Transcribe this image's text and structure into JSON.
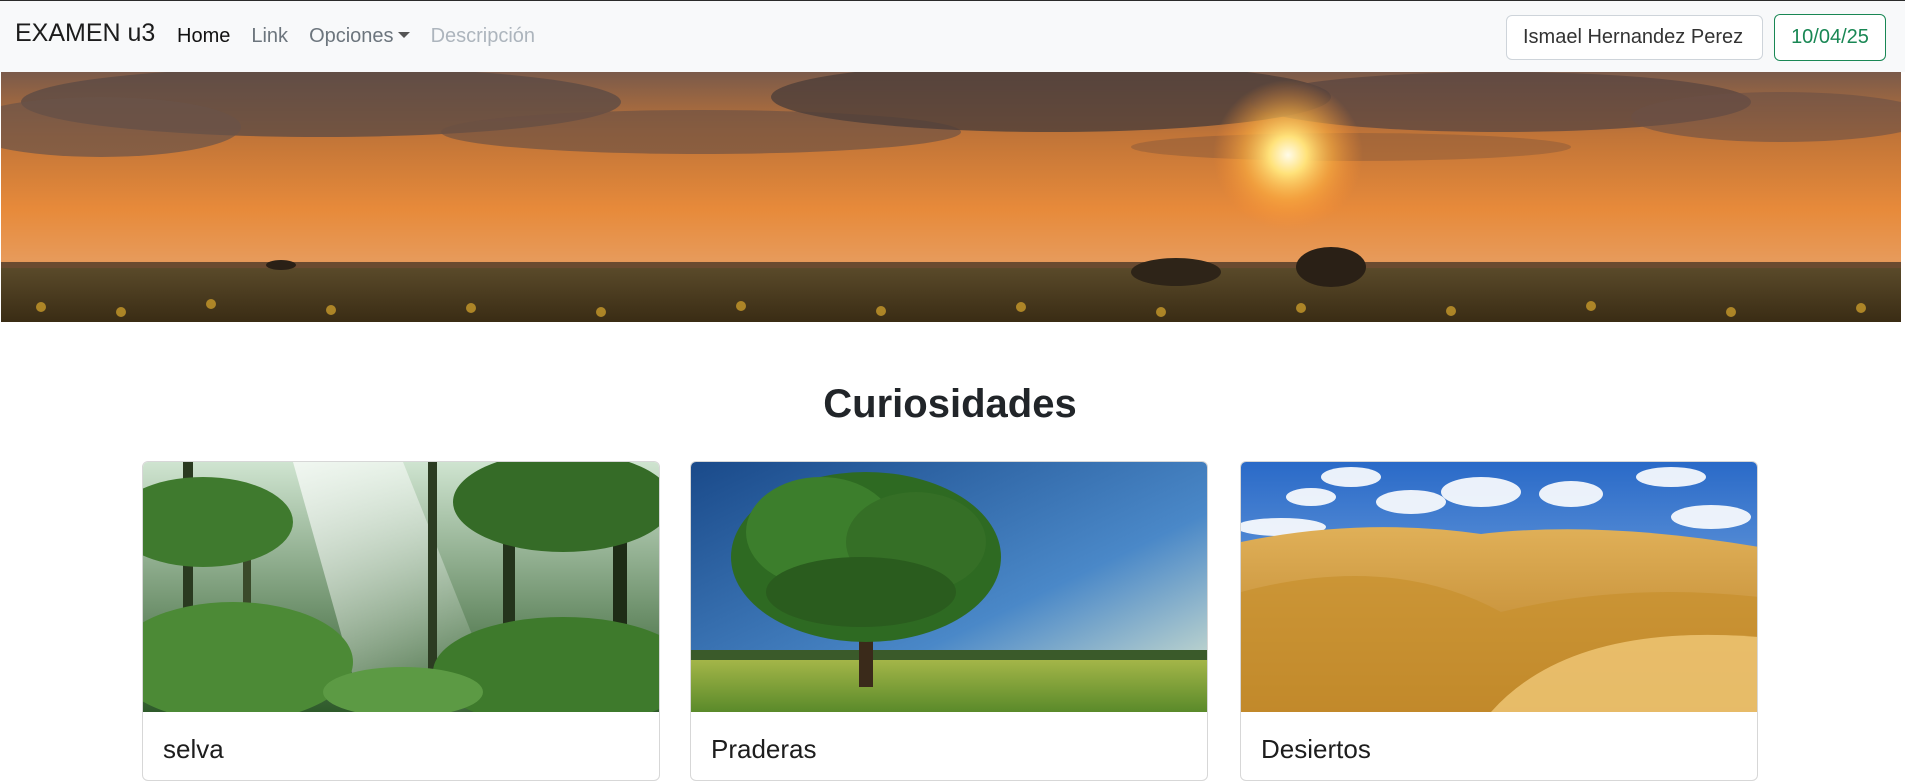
{
  "navbar": {
    "brand": "EXAMEN u3",
    "links": [
      {
        "label": "Home",
        "state": "active"
      },
      {
        "label": "Link",
        "state": "normal"
      },
      {
        "label": "Opciones",
        "state": "dropdown"
      },
      {
        "label": "Descripción",
        "state": "disabled"
      }
    ],
    "search_value": "Ismael Hernandez Perez",
    "date_button": "10/04/25"
  },
  "hero": {
    "scene": "sunset over sunflower field"
  },
  "section": {
    "title": "Curiosidades",
    "cards": [
      {
        "title": "selva",
        "image": "jungle"
      },
      {
        "title": "Praderas",
        "image": "meadow-tree"
      },
      {
        "title": "Desiertos",
        "image": "desert-dunes"
      }
    ]
  },
  "colors": {
    "navbar_bg": "#f8f9fa",
    "success": "#198754",
    "text": "#212529",
    "muted": "#6c757d"
  }
}
